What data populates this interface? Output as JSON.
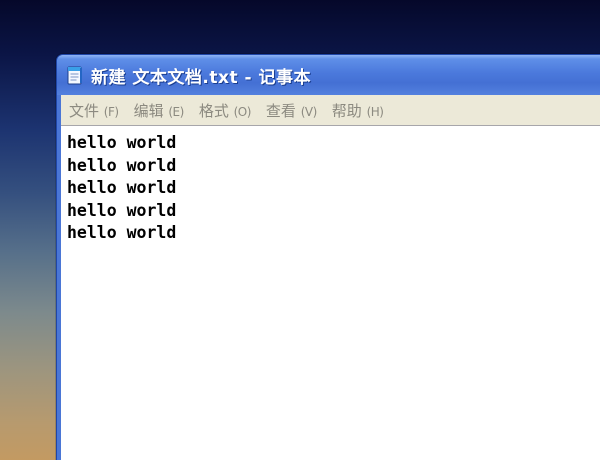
{
  "window": {
    "title": "新建 文本文档.txt - 记事本",
    "icon": "notepad-icon"
  },
  "menu": [
    {
      "label": "文件",
      "accel": "(F)"
    },
    {
      "label": "编辑",
      "accel": "(E)"
    },
    {
      "label": "格式",
      "accel": "(O)"
    },
    {
      "label": "查看",
      "accel": "(V)"
    },
    {
      "label": "帮助",
      "accel": "(H)"
    }
  ],
  "editor": {
    "lines": [
      "hello world",
      "hello world",
      "hello world",
      "hello world",
      "hello world"
    ]
  },
  "colors": {
    "titlebar": "#4b79dc",
    "menubar": "#ece9d8",
    "menu_text": "#8c8a80",
    "editor_bg": "#ffffff"
  }
}
